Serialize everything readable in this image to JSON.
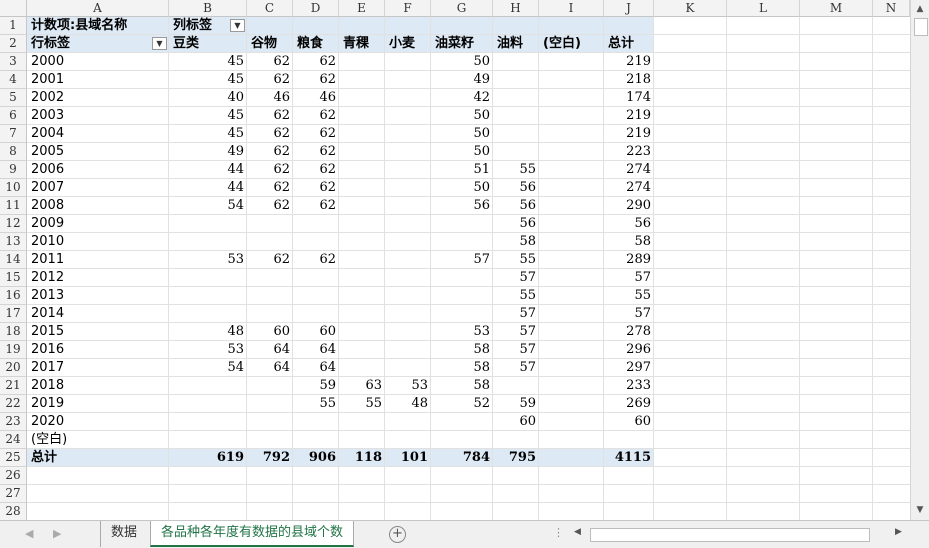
{
  "columns": [
    "A",
    "B",
    "C",
    "D",
    "E",
    "F",
    "G",
    "H",
    "I",
    "J",
    "K",
    "L",
    "M",
    "N"
  ],
  "row_numbers": [
    "1",
    "2",
    "3",
    "4",
    "5",
    "6",
    "7",
    "8",
    "9",
    "10",
    "11",
    "12",
    "13",
    "14",
    "15",
    "16",
    "17",
    "18",
    "19",
    "20",
    "21",
    "22",
    "23",
    "24",
    "25",
    "26",
    "27",
    "28"
  ],
  "pivot": {
    "count_label": "计数项:县域名称",
    "col_label": "列标签",
    "row_label": "行标签",
    "headers": [
      "豆类",
      "谷物",
      "粮食",
      "青稞",
      "小麦",
      "油菜籽",
      "油料",
      "(空白)",
      "总计"
    ],
    "rows": [
      {
        "year": "2000",
        "vals": [
          "45",
          "62",
          "62",
          "",
          "",
          "50",
          "",
          "",
          "219"
        ]
      },
      {
        "year": "2001",
        "vals": [
          "45",
          "62",
          "62",
          "",
          "",
          "49",
          "",
          "",
          "218"
        ]
      },
      {
        "year": "2002",
        "vals": [
          "40",
          "46",
          "46",
          "",
          "",
          "42",
          "",
          "",
          "174"
        ]
      },
      {
        "year": "2003",
        "vals": [
          "45",
          "62",
          "62",
          "",
          "",
          "50",
          "",
          "",
          "219"
        ]
      },
      {
        "year": "2004",
        "vals": [
          "45",
          "62",
          "62",
          "",
          "",
          "50",
          "",
          "",
          "219"
        ]
      },
      {
        "year": "2005",
        "vals": [
          "49",
          "62",
          "62",
          "",
          "",
          "50",
          "",
          "",
          "223"
        ]
      },
      {
        "year": "2006",
        "vals": [
          "44",
          "62",
          "62",
          "",
          "",
          "51",
          "55",
          "",
          "274"
        ]
      },
      {
        "year": "2007",
        "vals": [
          "44",
          "62",
          "62",
          "",
          "",
          "50",
          "56",
          "",
          "274"
        ]
      },
      {
        "year": "2008",
        "vals": [
          "54",
          "62",
          "62",
          "",
          "",
          "56",
          "56",
          "",
          "290"
        ]
      },
      {
        "year": "2009",
        "vals": [
          "",
          "",
          "",
          "",
          "",
          "",
          "56",
          "",
          "56"
        ]
      },
      {
        "year": "2010",
        "vals": [
          "",
          "",
          "",
          "",
          "",
          "",
          "58",
          "",
          "58"
        ]
      },
      {
        "year": "2011",
        "vals": [
          "53",
          "62",
          "62",
          "",
          "",
          "57",
          "55",
          "",
          "289"
        ]
      },
      {
        "year": "2012",
        "vals": [
          "",
          "",
          "",
          "",
          "",
          "",
          "57",
          "",
          "57"
        ]
      },
      {
        "year": "2013",
        "vals": [
          "",
          "",
          "",
          "",
          "",
          "",
          "55",
          "",
          "55"
        ]
      },
      {
        "year": "2014",
        "vals": [
          "",
          "",
          "",
          "",
          "",
          "",
          "57",
          "",
          "57"
        ]
      },
      {
        "year": "2015",
        "vals": [
          "48",
          "60",
          "60",
          "",
          "",
          "53",
          "57",
          "",
          "278"
        ]
      },
      {
        "year": "2016",
        "vals": [
          "53",
          "64",
          "64",
          "",
          "",
          "58",
          "57",
          "",
          "296"
        ]
      },
      {
        "year": "2017",
        "vals": [
          "54",
          "64",
          "64",
          "",
          "",
          "58",
          "57",
          "",
          "297"
        ]
      },
      {
        "year": "2018",
        "vals": [
          "",
          "",
          "59",
          "63",
          "53",
          "58",
          "",
          "",
          "233"
        ]
      },
      {
        "year": "2019",
        "vals": [
          "",
          "",
          "55",
          "55",
          "48",
          "52",
          "59",
          "",
          "269"
        ]
      },
      {
        "year": "2020",
        "vals": [
          "",
          "",
          "",
          "",
          "",
          "",
          "60",
          "",
          "60"
        ]
      },
      {
        "year": "(空白)",
        "vals": [
          "",
          "",
          "",
          "",
          "",
          "",
          "",
          "",
          ""
        ]
      }
    ],
    "total_label": "总计",
    "totals": [
      "619",
      "792",
      "906",
      "118",
      "101",
      "784",
      "795",
      "",
      "4115"
    ]
  },
  "tabs": [
    "数据",
    "各品种各年度有数据的县域个数"
  ],
  "active_tab": 1,
  "icons": {
    "filter": "dropdown-arrow-icon",
    "add": "plus-icon"
  },
  "colors": {
    "band": "#dde9f5",
    "active_tab": "#217346"
  }
}
